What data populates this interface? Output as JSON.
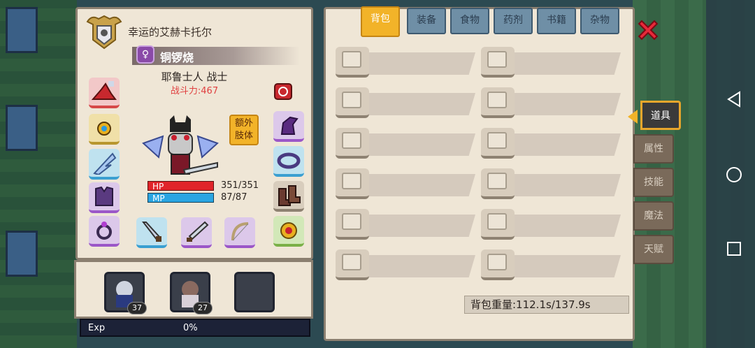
{
  "character": {
    "player_name": "幸运的艾赫卡托尔",
    "pet_name": "铜锣烧",
    "class_line": "耶鲁士人 战士",
    "power_line": "战斗力:467",
    "hp_label": "HP",
    "hp_value": "351/351",
    "mp_label": "MP",
    "mp_value": "87/87",
    "extra_limb_label": "额外肢体"
  },
  "pets": {
    "slot1_level": "37",
    "slot2_level": "27"
  },
  "exp": {
    "label": "Exp",
    "value": "0%"
  },
  "inventory": {
    "tabs": [
      "背包",
      "装备",
      "食物",
      "药剂",
      "书籍",
      "杂物"
    ],
    "active_tab": "背包",
    "weight_text": "背包重量:112.1s/137.9s"
  },
  "side_tabs": [
    "道具",
    "属性",
    "技能",
    "魔法",
    "天赋"
  ],
  "active_side_tab": "道具",
  "colors": {
    "accent": "#f2b329",
    "panel": "#efe6d6",
    "hp": "#e0242a",
    "mp": "#2aa5e2",
    "power": "#e04040",
    "close": "#e8293a"
  }
}
